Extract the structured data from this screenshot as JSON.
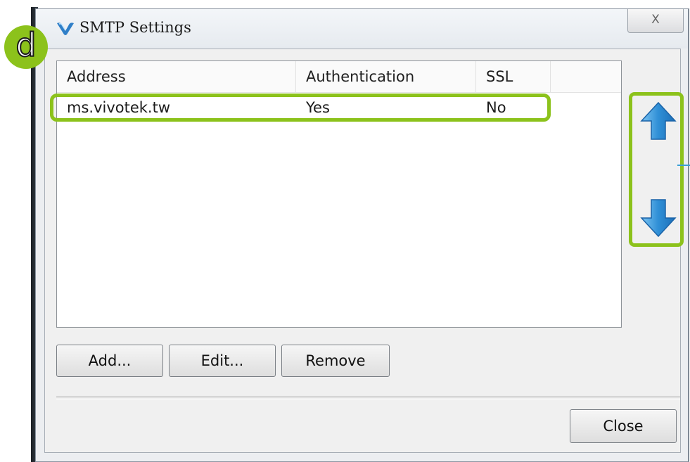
{
  "window": {
    "title": "SMTP Settings",
    "close_glyph": "X"
  },
  "table": {
    "columns": [
      "Address",
      "Authentication",
      "SSL"
    ],
    "rows": [
      {
        "address": "ms.vivotek.tw",
        "authentication": "Yes",
        "ssl": "No"
      }
    ]
  },
  "buttons": {
    "add": "Add...",
    "edit": "Edit...",
    "remove": "Remove",
    "close": "Close"
  },
  "annotation": {
    "badge": "d",
    "highlight_color": "#8cc21b"
  },
  "icons": {
    "app": "vivotek-logo-icon",
    "move_up": "arrow-up-icon",
    "move_down": "arrow-down-icon"
  }
}
